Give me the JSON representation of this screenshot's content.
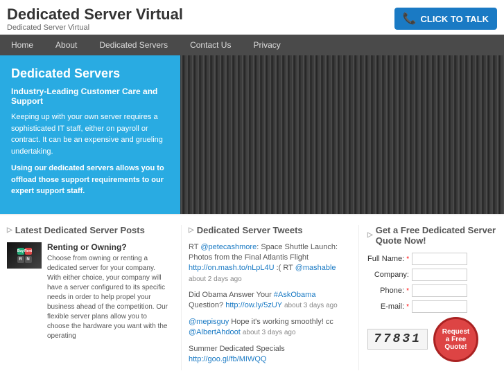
{
  "header": {
    "title": "Dedicated Server Virtual",
    "subtitle": "Dedicated Server Virtual",
    "cta_label": "CLICK TO TALK"
  },
  "nav": {
    "items": [
      {
        "label": "Home",
        "active": false
      },
      {
        "label": "About",
        "active": false
      },
      {
        "label": "Dedicated Servers",
        "active": false
      },
      {
        "label": "Contact Us",
        "active": false
      },
      {
        "label": "Privacy",
        "active": false
      }
    ]
  },
  "hero": {
    "title": "Dedicated Servers",
    "subtitle": "Industry-Leading Customer Care and Support",
    "para1": "Keeping up with your own server requires a sophisticated IT staff, either on payroll or contract. It can be an expensive and grueling undertaking.",
    "para2": "Using our dedicated servers allows you to offload those support requirements to our expert support staff."
  },
  "posts": {
    "col_title": "Latest Dedicated Server Posts",
    "post_title": "Renting or Owning?",
    "post_body": "Choose from owning or renting a dedicated server for your company. With either choice, your company will have a server configured to its specific needs in order to help propel your business ahead of the competition. Our flexible server plans allow you to choose the hardware you want with the operating"
  },
  "tweets": {
    "col_title": "Dedicated Server Tweets",
    "items": [
      {
        "text": "RT ",
        "handle": "@petecashmore",
        "middle": ": Space Shuttle Launch: Photos from the Final Atlantis Flight ",
        "link": "http://on.mash.to/nLpL4U",
        "suffix": " :( RT ",
        "handle2": "@mashable",
        "time": "about 2 days ago",
        "rest": ""
      },
      {
        "text": "Did Obama Answer Your ",
        "link_text": "#AskObama",
        "link": "http://ow.ly/5zUY",
        "suffix": " Question?",
        "time": "about 3 days ago"
      },
      {
        "handle": "@mepisguy",
        "text": " Hope it's working smoothly! cc ",
        "handle2": "@AlbertAhdoot",
        "time": "about 3 days ago"
      },
      {
        "text": "Summer Dedicated Specials ",
        "link": "http://goo.gl/fb/MIWQQ"
      }
    ]
  },
  "quote": {
    "col_title": "Get a Free Dedicated Server Quote Now!",
    "fields": [
      {
        "label": "Full Name:",
        "required": true
      },
      {
        "label": "Company:",
        "required": false
      },
      {
        "label": "Phone:",
        "required": true
      },
      {
        "label": "E-mail:",
        "required": true
      }
    ],
    "btn_line1": "Request",
    "btn_line2": "a Free",
    "btn_line3": "Quote!",
    "captcha": "77831"
  }
}
